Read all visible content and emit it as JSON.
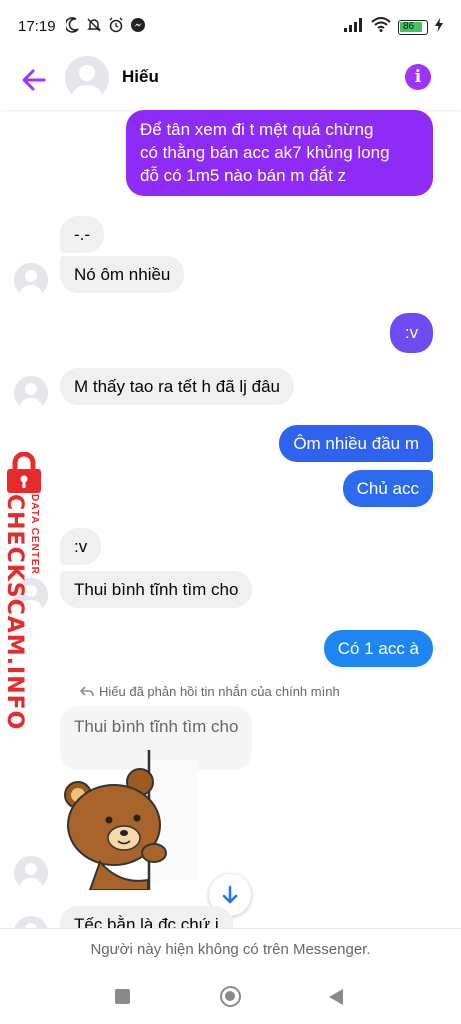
{
  "status_bar": {
    "time": "17:19",
    "battery": "86"
  },
  "header": {
    "contact_name": "Hiếu"
  },
  "messages": [
    {
      "dir": "out",
      "lines": [
        "Để tân xem đi t mệt quá chừng",
        "có thằng bán acc ak7 khủng long",
        "đỗ có 1m5 nào bán m đắt z"
      ]
    },
    {
      "dir": "in",
      "text": "-.-"
    },
    {
      "dir": "in",
      "text": "Nó ôm nhiều"
    },
    {
      "dir": "out",
      "text": ":v"
    },
    {
      "dir": "in",
      "text": "M thấy tao ra tết h đã lj đâu"
    },
    {
      "dir": "out",
      "text": "Ôm nhiều đầu m"
    },
    {
      "dir": "out",
      "text": "Chủ acc"
    },
    {
      "dir": "in",
      "text": ":v"
    },
    {
      "dir": "in",
      "text": "Thui bình tĩnh tìm cho"
    },
    {
      "dir": "out",
      "text": "Có 1 acc à"
    },
    {
      "dir": "in",
      "text": "Tếc bằn là đc chứ j"
    }
  ],
  "reply_note": "Hiếu đã phản hồi tin nhắn của chính mình",
  "quoted_message": "Thui bình tĩnh tìm cho",
  "footer": {
    "notice": "Người này hiện không có trên Messenger."
  },
  "watermark": {
    "main": "CHECKSCAM.INFO",
    "sub": "DATA CENTER"
  },
  "colors": {
    "accent_purple": "#a033ff",
    "out_purple": "#8e2bf6",
    "out_blue": "#2a6bf0",
    "incoming_bg": "#f0f0f0"
  }
}
